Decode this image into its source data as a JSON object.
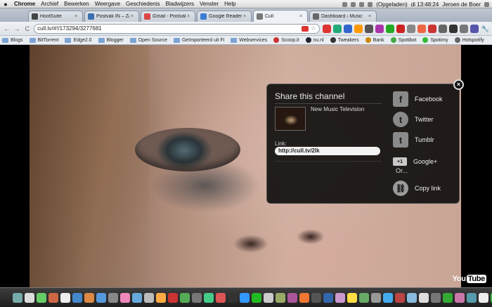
{
  "menubar": {
    "apple": "",
    "items": [
      "Chrome",
      "Archief",
      "Bewerken",
      "Weergave",
      "Geschiedenis",
      "Bladwijzers",
      "Venster",
      "Help"
    ],
    "battery": "(Opgeladen)",
    "clock": "di 13:48:24",
    "user": "Jeroen de Boer"
  },
  "tabs": [
    {
      "label": "HootSuite",
      "color": "#444"
    },
    {
      "label": "Postvak IN – Zarafi",
      "color": "#3a6fb0"
    },
    {
      "label": "Gmail - Postvak IN",
      "color": "#d44"
    },
    {
      "label": "Google Reader (10",
      "color": "#3a7bd5"
    },
    {
      "label": "Cull",
      "color": "#777"
    },
    {
      "label": "Dashboard ‹ Music",
      "color": "#666"
    }
  ],
  "toolbar": {
    "back": "←",
    "forward": "→",
    "reload": "C",
    "url": "cull.tv/#!/173294/3277681",
    "star": "☆",
    "wrench": "🔧"
  },
  "extensions": [
    "#d33",
    "#2a7",
    "#36c",
    "#f90",
    "#555",
    "#a3a",
    "#2a2",
    "#c22",
    "#888",
    "#e64",
    "#c33",
    "#666",
    "#333",
    "#777",
    "#55a"
  ],
  "bookmarks": [
    {
      "label": "Blogs",
      "type": "folder"
    },
    {
      "label": "BitTorrent",
      "type": "folder"
    },
    {
      "label": "Edge2.0",
      "type": "folder"
    },
    {
      "label": "Blogger",
      "type": "folder"
    },
    {
      "label": "Open Source",
      "type": "folder"
    },
    {
      "label": "Geïmporteerd uit Fi",
      "type": "folder"
    },
    {
      "label": "Webservices",
      "type": "folder"
    },
    {
      "label": "Scoop.it",
      "type": "site",
      "color": "#c33"
    },
    {
      "label": "nu.nl",
      "type": "site",
      "color": "#223"
    },
    {
      "label": "Tweakers",
      "type": "site",
      "color": "#333"
    },
    {
      "label": "Bank",
      "type": "site",
      "color": "#c80"
    },
    {
      "label": "Spotibot",
      "type": "site",
      "color": "#4a4"
    },
    {
      "label": "Spotimy",
      "type": "site",
      "color": "#3b3"
    },
    {
      "label": "Hotspotify",
      "type": "site",
      "color": "#666"
    }
  ],
  "share": {
    "title": "Share this channel",
    "channel_name": "New Music Television",
    "link_label": "Link:",
    "link_value": "http://cull.tv/2lk",
    "or_label": "Or...",
    "close": "×",
    "networks": {
      "facebook": {
        "label": "Facebook",
        "glyph": "f"
      },
      "twitter": {
        "label": "Twitter",
        "glyph": "t"
      },
      "tumblr": {
        "label": "Tumblr",
        "glyph": "t"
      },
      "google": {
        "label": "Google+",
        "glyph": "+1"
      },
      "copy": {
        "label": "Copy link",
        "glyph": "⛓"
      }
    }
  },
  "video": {
    "youtube_logo_you": "You",
    "youtube_logo_tube": "Tube"
  },
  "dock": {
    "apps": [
      "#7aa",
      "#ddd",
      "#6c6",
      "#c64",
      "#eee",
      "#48c",
      "#d84",
      "#59d",
      "#888",
      "#e8b",
      "#6ad",
      "#bbb",
      "#fa4",
      "#c33",
      "#5a5",
      "#777",
      "#4c8",
      "#d55",
      "#333",
      "#39f",
      "#2b2",
      "#ccc",
      "#9a6",
      "#a59",
      "#e73",
      "#555",
      "#36a",
      "#c9c",
      "#fd4",
      "#6a6",
      "#999",
      "#4ae",
      "#b44",
      "#8bd",
      "#ddd",
      "#777",
      "#3a3",
      "#c7a",
      "#59a",
      "#eee",
      "#4b4",
      "#d93"
    ]
  }
}
